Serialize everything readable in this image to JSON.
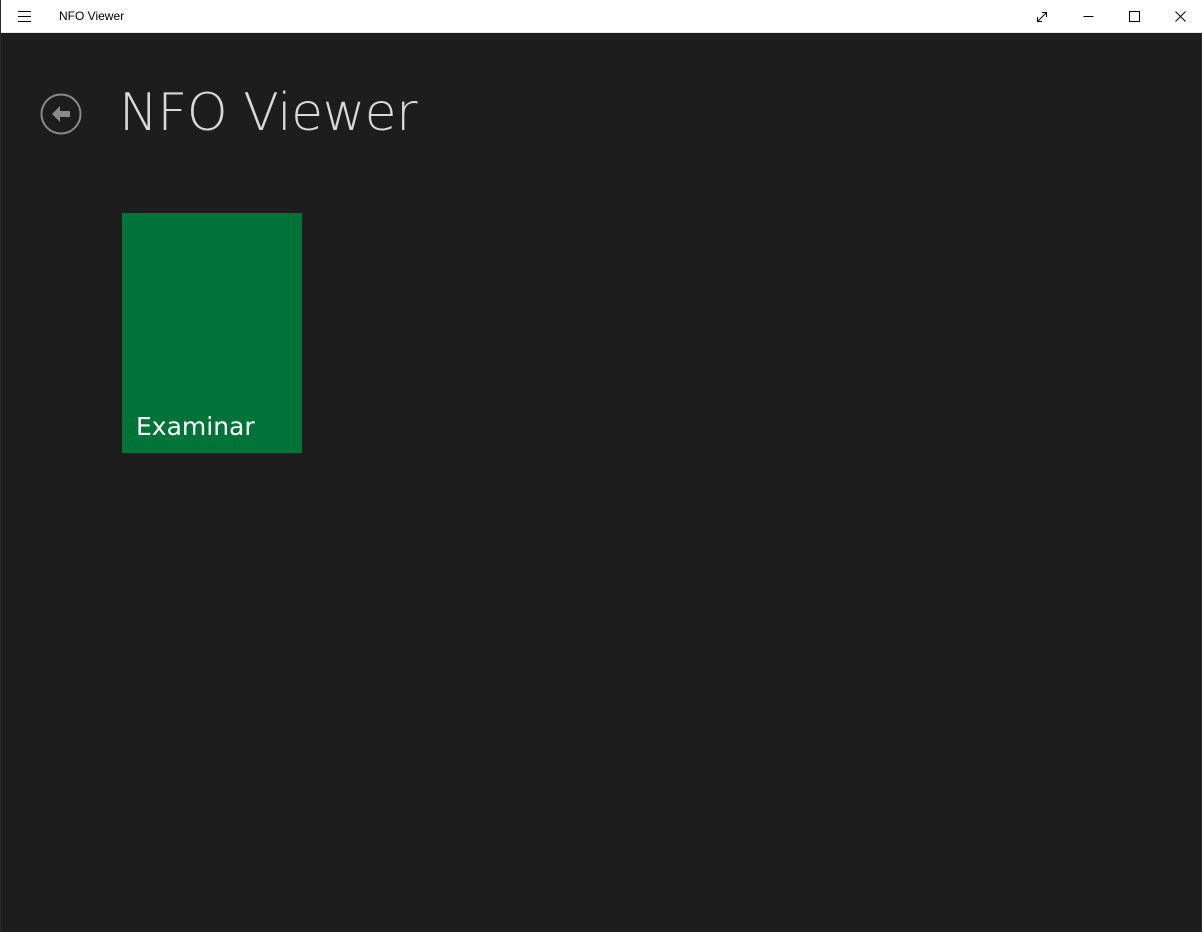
{
  "titlebar": {
    "app_title": "NFO Viewer",
    "menu_icon": "hamburger-icon",
    "buttons": {
      "fullscreen_icon": "expand-diagonal-icon",
      "minimize_icon": "minimize-icon",
      "maximize_icon": "maximize-icon",
      "close_icon": "close-icon"
    }
  },
  "header": {
    "back_icon": "back-arrow-circle-icon",
    "title": "NFO Viewer"
  },
  "tiles": [
    {
      "label": "Examinar",
      "color": "#007438"
    }
  ],
  "colors": {
    "background": "#1d1d1d",
    "titlebar": "#ffffff",
    "title_text": "#d9d9d9",
    "tile": "#007438"
  }
}
